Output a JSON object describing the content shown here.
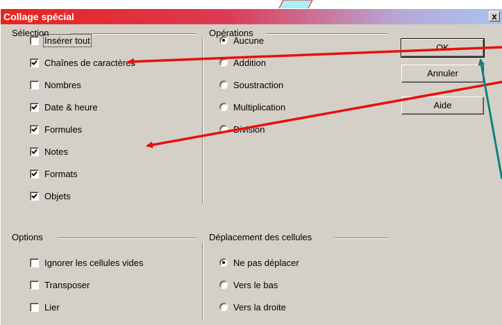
{
  "dialog": {
    "title": "Collage spécial",
    "close_label": "x"
  },
  "selection": {
    "title": "Sélection",
    "items": [
      {
        "label": "Insérer tout",
        "checked": false
      },
      {
        "label": "Chaînes de caractères",
        "checked": true
      },
      {
        "label": "Nombres",
        "checked": false
      },
      {
        "label": "Date & heure",
        "checked": true
      },
      {
        "label": "Formules",
        "checked": true
      },
      {
        "label": "Notes",
        "checked": true
      },
      {
        "label": "Formats",
        "checked": true
      },
      {
        "label": "Objets",
        "checked": true
      }
    ]
  },
  "operations": {
    "title": "Opérations",
    "items": [
      {
        "label": "Aucune",
        "selected": true
      },
      {
        "label": "Addition",
        "selected": false
      },
      {
        "label": "Soustraction",
        "selected": false
      },
      {
        "label": "Multiplication",
        "selected": false
      },
      {
        "label": "Division",
        "selected": false
      }
    ]
  },
  "options": {
    "title": "Options",
    "items": [
      {
        "label": "Ignorer les cellules vides",
        "checked": false
      },
      {
        "label": "Transposer",
        "checked": false
      },
      {
        "label": "Lier",
        "checked": false
      }
    ]
  },
  "shift": {
    "title": "Déplacement des cellules",
    "items": [
      {
        "label": "Ne pas déplacer",
        "selected": true
      },
      {
        "label": "Vers le bas",
        "selected": false
      },
      {
        "label": "Vers la droite",
        "selected": false
      }
    ]
  },
  "buttons": {
    "ok": "OK",
    "cancel": "Annuler",
    "help": "Aide"
  },
  "colors": {
    "annotation_red": "#e8100c",
    "annotation_teal": "#0f8080"
  }
}
